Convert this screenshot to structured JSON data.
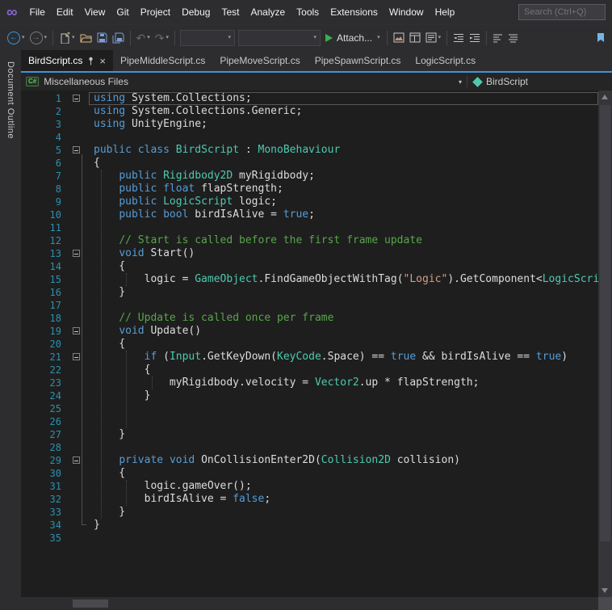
{
  "app": {
    "search_placeholder": "Search (Ctrl+Q)"
  },
  "menu": {
    "items": [
      "File",
      "Edit",
      "View",
      "Git",
      "Project",
      "Debug",
      "Test",
      "Analyze",
      "Tools",
      "Extensions",
      "Window",
      "Help"
    ]
  },
  "icons": {
    "infinity": "∞",
    "back": "←",
    "forward": "→",
    "undo": "↶",
    "redo": "↷",
    "chevron": "▾",
    "close": "×",
    "csharp": "C#"
  },
  "toolbar": {
    "attach_label": "Attach..."
  },
  "tabs": [
    {
      "label": "BirdScript.cs",
      "active": true
    },
    {
      "label": "PipeMiddleScript.cs"
    },
    {
      "label": "PipeMoveScript.cs"
    },
    {
      "label": "PipeSpawnScript.cs"
    },
    {
      "label": "LogicScript.cs"
    }
  ],
  "breadcrumb": {
    "scope": "Miscellaneous Files",
    "member": "BirdScript"
  },
  "side_panel": {
    "label": "Document Outline"
  },
  "colors": {
    "accent": "#3a96dd",
    "keyword": "#569cd6",
    "type": "#4ec9b0",
    "string": "#d69d85",
    "comment": "#57a64a",
    "text": "#dcdcdc",
    "line_number": "#2b91af",
    "editor_bg": "#1e1e1e",
    "chrome_bg": "#2d2d30"
  },
  "editor": {
    "current_line": 1,
    "fold_lines": [
      1,
      5,
      13,
      19,
      21,
      29
    ],
    "indent_guides": [
      {
        "col": 0,
        "from": 7,
        "to": 33
      },
      {
        "col": 4,
        "from": 15,
        "to": 15
      },
      {
        "col": 4,
        "from": 21,
        "to": 26
      },
      {
        "col": 4,
        "from": 31,
        "to": 32
      },
      {
        "col": 8,
        "from": 23,
        "to": 23
      }
    ],
    "lines": [
      [
        [
          "k",
          "using"
        ],
        [
          "p",
          " System.Collections;"
        ]
      ],
      [
        [
          "k",
          "using"
        ],
        [
          "p",
          " System.Collections.Generic;"
        ]
      ],
      [
        [
          "k",
          "using"
        ],
        [
          "p",
          " UnityEngine;"
        ]
      ],
      [],
      [
        [
          "k",
          "public"
        ],
        [
          "p",
          " "
        ],
        [
          "k",
          "class"
        ],
        [
          "p",
          " "
        ],
        [
          "t",
          "BirdScript"
        ],
        [
          "p",
          " : "
        ],
        [
          "t",
          "MonoBehaviour"
        ]
      ],
      [
        [
          "p",
          "{"
        ]
      ],
      [
        [
          "p",
          "    "
        ],
        [
          "k",
          "public"
        ],
        [
          "p",
          " "
        ],
        [
          "t",
          "Rigidbody2D"
        ],
        [
          "p",
          " myRigidbody;"
        ]
      ],
      [
        [
          "p",
          "    "
        ],
        [
          "k",
          "public"
        ],
        [
          "p",
          " "
        ],
        [
          "k",
          "float"
        ],
        [
          "p",
          " flapStrength;"
        ]
      ],
      [
        [
          "p",
          "    "
        ],
        [
          "k",
          "public"
        ],
        [
          "p",
          " "
        ],
        [
          "t",
          "LogicScript"
        ],
        [
          "p",
          " logic;"
        ]
      ],
      [
        [
          "p",
          "    "
        ],
        [
          "k",
          "public"
        ],
        [
          "p",
          " "
        ],
        [
          "k",
          "bool"
        ],
        [
          "p",
          " birdIsAlive = "
        ],
        [
          "k",
          "true"
        ],
        [
          "p",
          ";"
        ]
      ],
      [],
      [
        [
          "p",
          "    "
        ],
        [
          "c",
          "// Start is called before the first frame update"
        ]
      ],
      [
        [
          "p",
          "    "
        ],
        [
          "k",
          "void"
        ],
        [
          "p",
          " Start()"
        ]
      ],
      [
        [
          "p",
          "    {"
        ]
      ],
      [
        [
          "p",
          "        logic = "
        ],
        [
          "t",
          "GameObject"
        ],
        [
          "p",
          ".FindGameObjectWithTag("
        ],
        [
          "s",
          "\"Logic\""
        ],
        [
          "p",
          ").GetComponent<"
        ],
        [
          "t",
          "LogicScript"
        ],
        [
          "p",
          ">();"
        ]
      ],
      [
        [
          "p",
          "    }"
        ]
      ],
      [],
      [
        [
          "p",
          "    "
        ],
        [
          "c",
          "// Update is called once per frame"
        ]
      ],
      [
        [
          "p",
          "    "
        ],
        [
          "k",
          "void"
        ],
        [
          "p",
          " Update()"
        ]
      ],
      [
        [
          "p",
          "    {"
        ]
      ],
      [
        [
          "p",
          "        "
        ],
        [
          "k",
          "if"
        ],
        [
          "p",
          " ("
        ],
        [
          "t",
          "Input"
        ],
        [
          "p",
          ".GetKeyDown("
        ],
        [
          "t",
          "KeyCode"
        ],
        [
          "p",
          ".Space) == "
        ],
        [
          "k",
          "true"
        ],
        [
          "p",
          " && birdIsAlive == "
        ],
        [
          "k",
          "true"
        ],
        [
          "p",
          ")"
        ]
      ],
      [
        [
          "p",
          "        {"
        ]
      ],
      [
        [
          "p",
          "            myRigidbody.velocity = "
        ],
        [
          "t",
          "Vector2"
        ],
        [
          "p",
          ".up * flapStrength;"
        ]
      ],
      [
        [
          "p",
          "        }"
        ]
      ],
      [],
      [],
      [
        [
          "p",
          "    }"
        ]
      ],
      [],
      [
        [
          "p",
          "    "
        ],
        [
          "k",
          "private"
        ],
        [
          "p",
          " "
        ],
        [
          "k",
          "void"
        ],
        [
          "p",
          " OnCollisionEnter2D("
        ],
        [
          "t",
          "Collision2D"
        ],
        [
          "p",
          " collision)"
        ]
      ],
      [
        [
          "p",
          "    {"
        ]
      ],
      [
        [
          "p",
          "        logic.gameOver();"
        ]
      ],
      [
        [
          "p",
          "        birdIsAlive = "
        ],
        [
          "k",
          "false"
        ],
        [
          "p",
          ";"
        ]
      ],
      [
        [
          "p",
          "    }"
        ]
      ],
      [
        [
          "p",
          "}"
        ]
      ],
      []
    ]
  }
}
